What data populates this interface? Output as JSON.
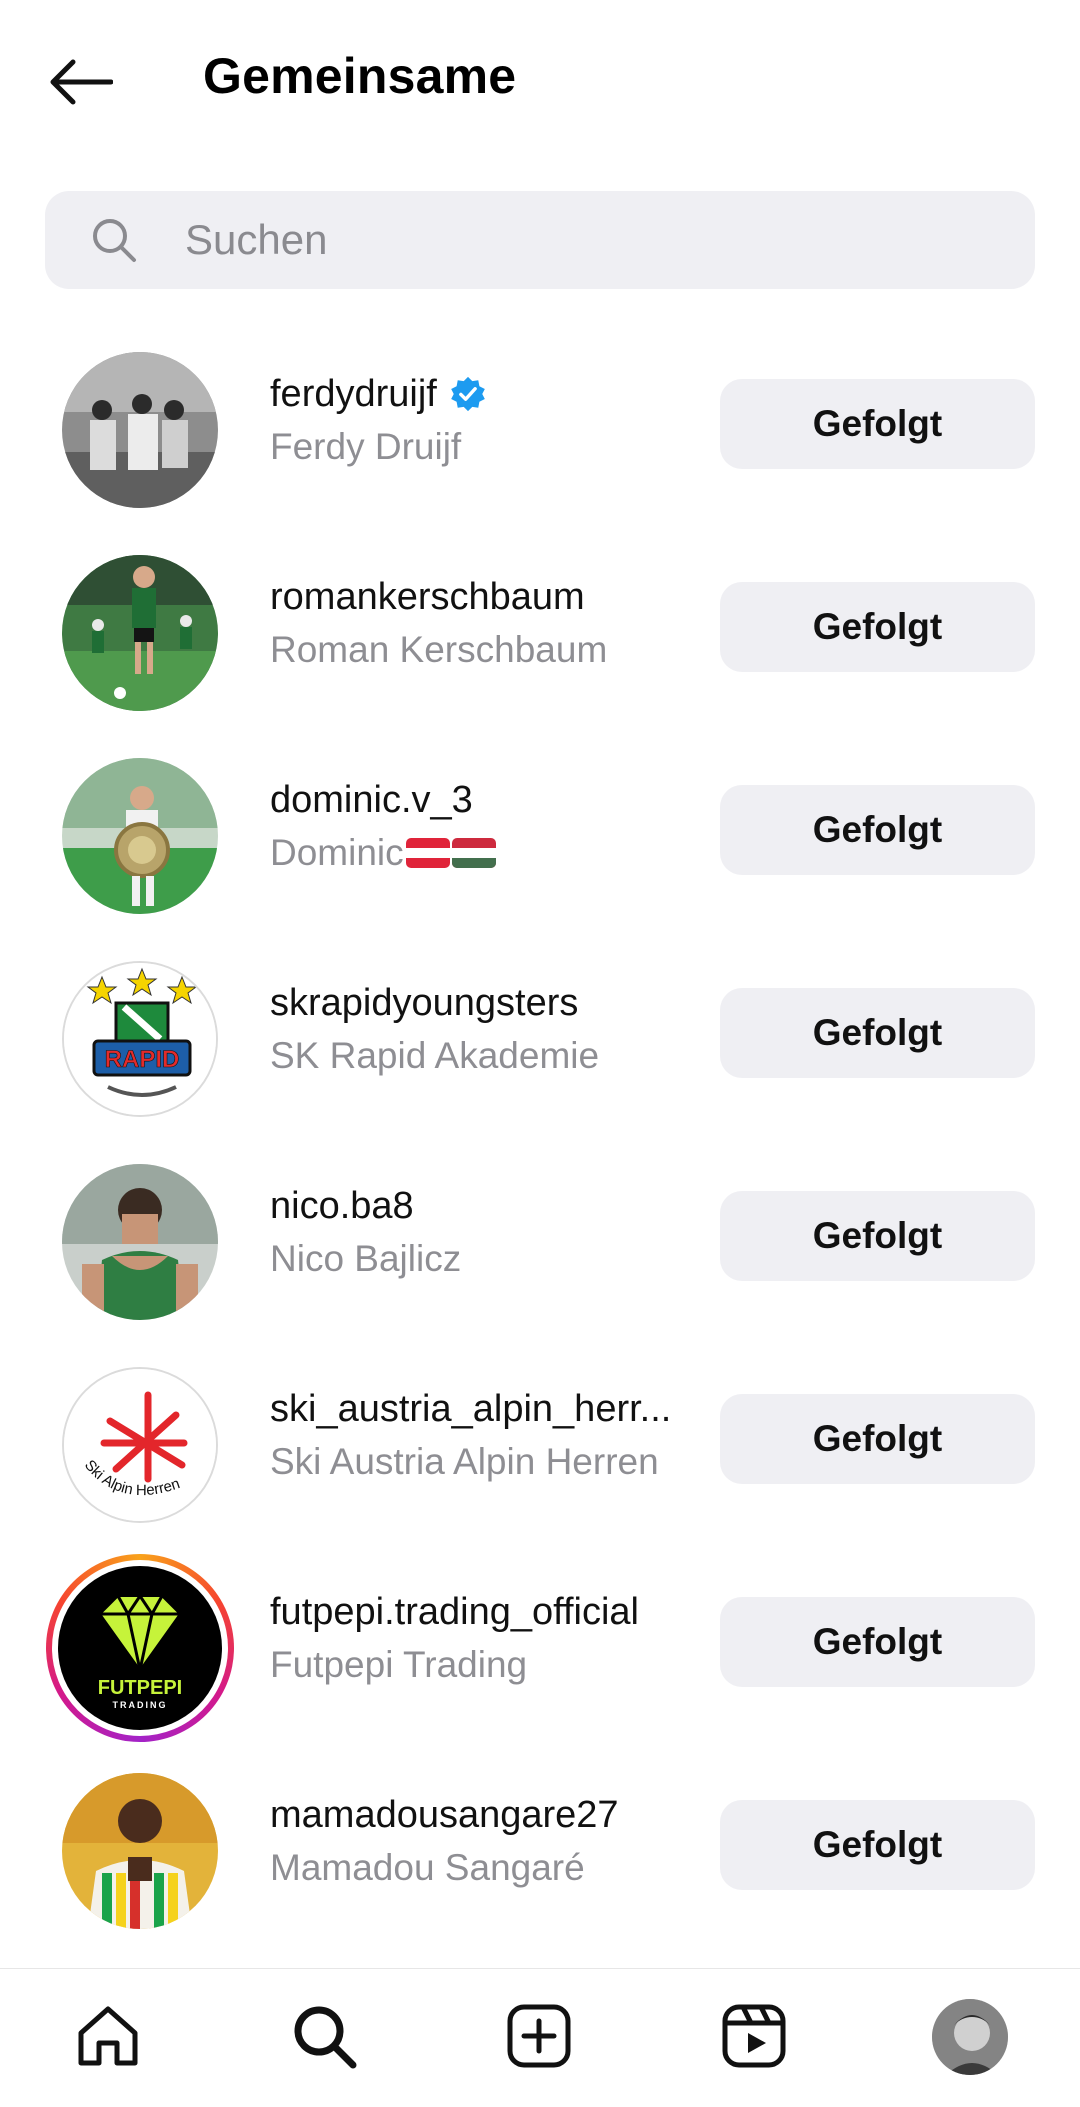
{
  "header": {
    "title": "Gemeinsame"
  },
  "search": {
    "placeholder": "Suchen"
  },
  "users": [
    {
      "username": "ferdydruijf",
      "fullname": "Ferdy Druijf",
      "verified": true,
      "button": "Gefolgt"
    },
    {
      "username": "romankerschbaum",
      "fullname": "Roman Kerschbaum",
      "verified": false,
      "button": "Gefolgt"
    },
    {
      "username": "dominic.v_3",
      "fullname": "Dominic",
      "verified": false,
      "button": "Gefolgt"
    },
    {
      "username": "skrapidyoungsters",
      "fullname": "SK Rapid Akademie",
      "verified": false,
      "button": "Gefolgt"
    },
    {
      "username": "nico.ba8",
      "fullname": "Nico Bajlicz",
      "verified": false,
      "button": "Gefolgt"
    },
    {
      "username": "ski_austria_alpin_herr...",
      "fullname": "Ski Austria Alpin Herren",
      "verified": false,
      "button": "Gefolgt"
    },
    {
      "username": "futpepi.trading_official",
      "fullname": "Futpepi Trading",
      "verified": false,
      "button": "Gefolgt"
    },
    {
      "username": "mamadousangare27",
      "fullname": "Mamadou Sangaré",
      "verified": false,
      "button": "Gefolgt"
    }
  ],
  "logos": {
    "rapid": "RAPID",
    "ski": "Ski Alpin Herren",
    "futpepi": "FUTPEPI",
    "futpepi_sub": "TRADING"
  },
  "tabbar": {
    "items": [
      "home-icon",
      "search-icon",
      "create-icon",
      "reels-icon",
      "profile-avatar"
    ]
  },
  "colors": {
    "accent_verified": "#1d9bf0",
    "button_bg": "#efeff3",
    "secondary_text": "#8e8e93"
  }
}
